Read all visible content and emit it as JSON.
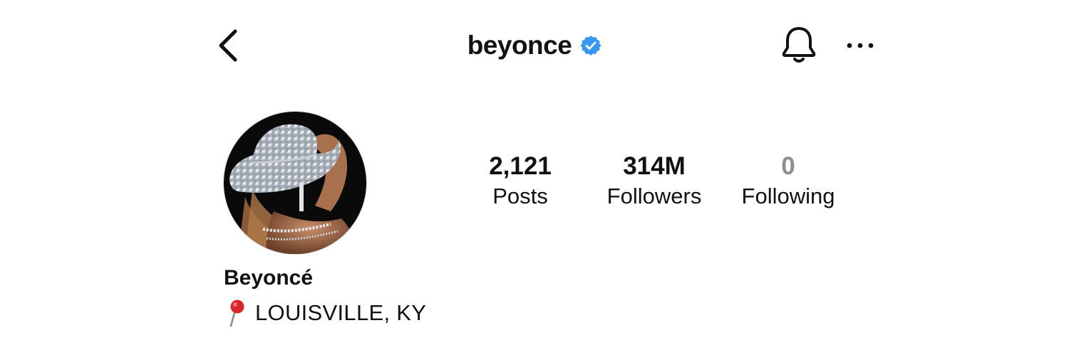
{
  "header": {
    "username": "beyonce",
    "verified": true,
    "accent_color": "#3897f0",
    "icons": [
      "chevron-left-icon",
      "verified-badge-icon",
      "bell-icon",
      "more-horizontal-icon"
    ]
  },
  "profile": {
    "display_name": "Beyoncé",
    "location": "LOUISVILLE, KY",
    "location_icon": "round-pushpin-icon"
  },
  "stats": {
    "posts": {
      "value": "2,121",
      "label": "Posts"
    },
    "followers": {
      "value": "314M",
      "label": "Followers"
    },
    "following": {
      "value": "0",
      "label": "Following"
    }
  }
}
